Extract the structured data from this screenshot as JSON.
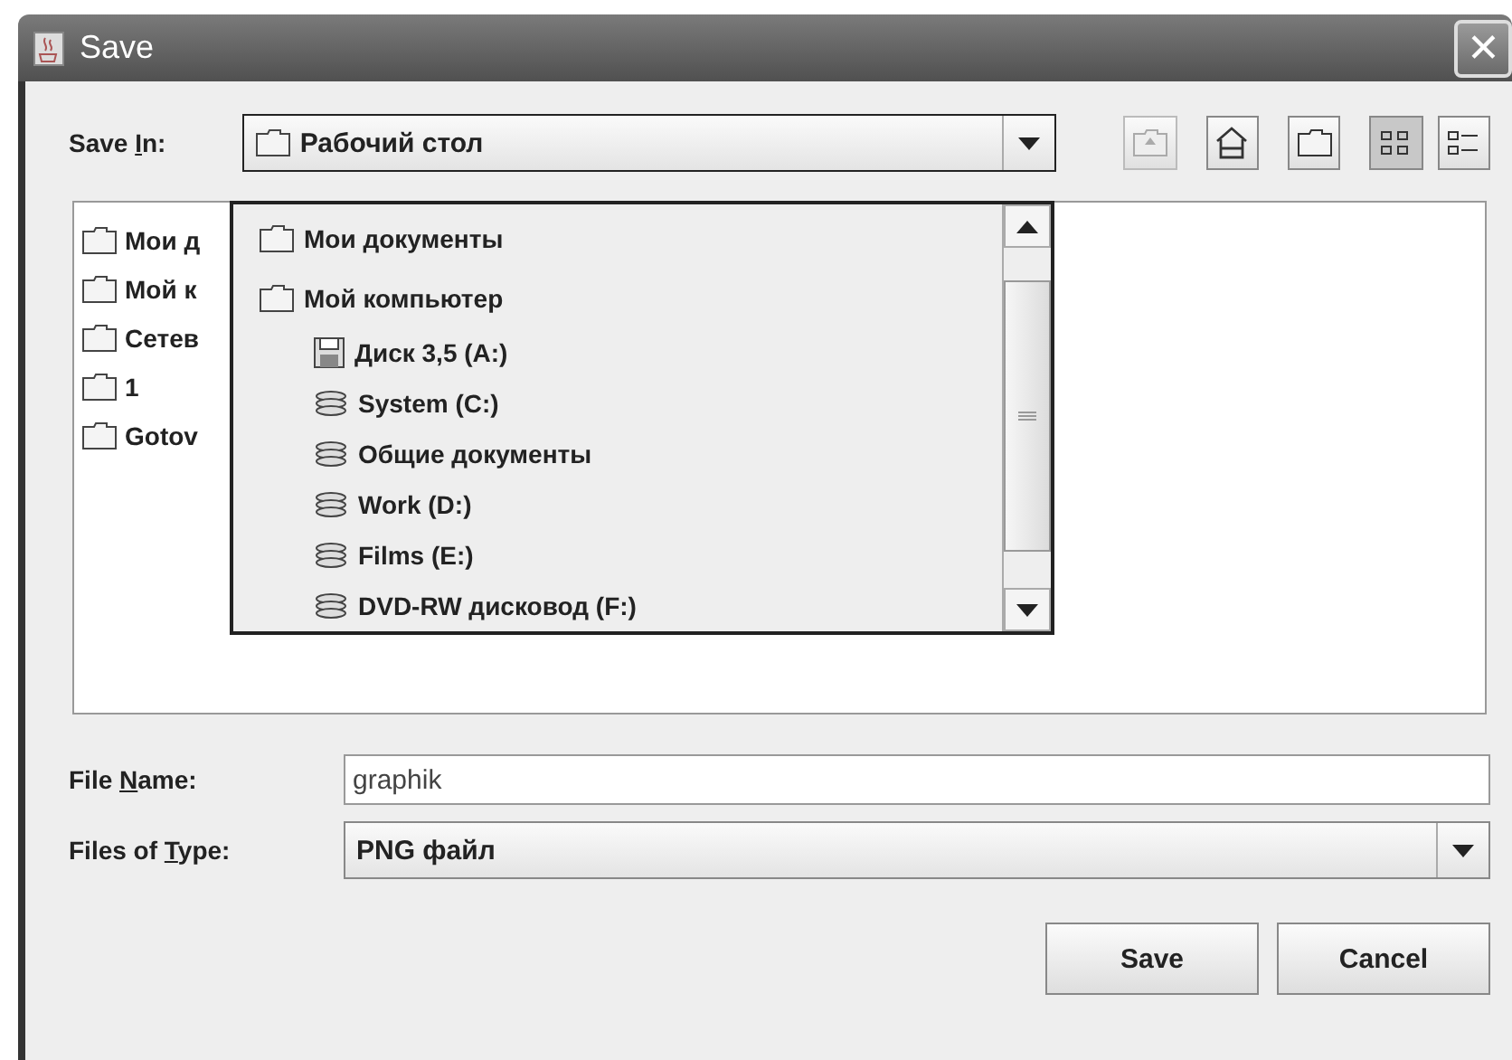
{
  "window": {
    "title": "Save",
    "close": "✕"
  },
  "save_in": {
    "label_parts": [
      "Save ",
      "I",
      "n:"
    ],
    "value": "Рабочий стол",
    "expanded": true
  },
  "toolbar": [
    {
      "kind": "up",
      "disabled": true,
      "selected": false
    },
    {
      "kind": "home",
      "disabled": false,
      "selected": false
    },
    {
      "kind": "new-folder",
      "disabled": false,
      "selected": false
    },
    {
      "kind": "list",
      "disabled": false,
      "selected": true
    },
    {
      "kind": "details",
      "disabled": false,
      "selected": false
    }
  ],
  "files": [
    "Мои д",
    "Мой к",
    "Сетев",
    "1",
    "Gotov"
  ],
  "dropdown": [
    {
      "label": "Мои документы",
      "kind": "folder"
    },
    {
      "label": "Мой компьютер",
      "kind": "folder",
      "children": [
        {
          "label": "Диск 3,5 (A:)",
          "kind": "floppy"
        },
        {
          "label": "System (C:)",
          "kind": "drive"
        },
        {
          "label": "Общие документы",
          "kind": "drive"
        },
        {
          "label": "Work (D:)",
          "kind": "drive"
        },
        {
          "label": "Films (E:)",
          "kind": "drive"
        },
        {
          "label": "DVD-RW дисковод (F:)",
          "kind": "drive"
        }
      ]
    }
  ],
  "file_name": {
    "label_parts": [
      "File ",
      "N",
      "ame:"
    ],
    "value": "graphik"
  },
  "file_type": {
    "label_parts": [
      "Files of ",
      "T",
      "ype:"
    ],
    "value": "PNG файл"
  },
  "buttons": [
    "Save",
    "Cancel"
  ]
}
